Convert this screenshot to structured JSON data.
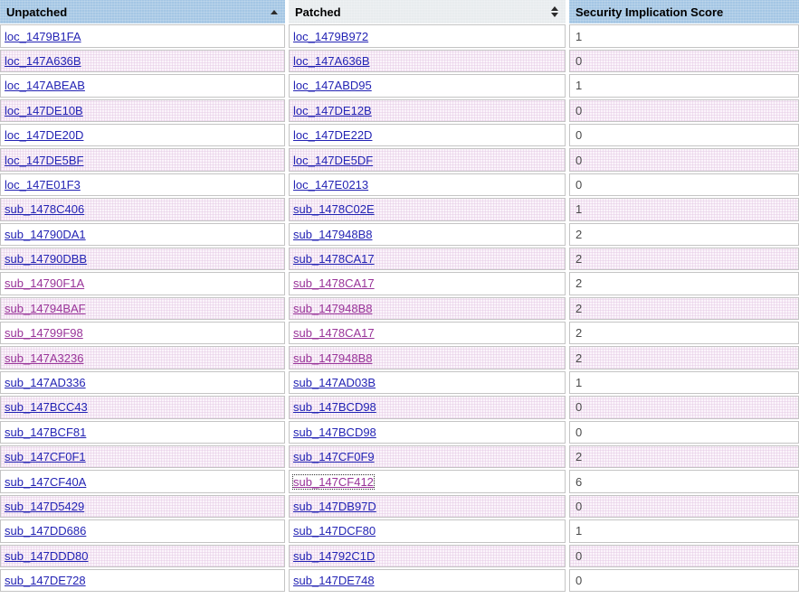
{
  "table": {
    "columns": [
      {
        "label": "Unpatched",
        "sort_state": "ascending",
        "icon": "sort-ascending-icon"
      },
      {
        "label": "Patched",
        "sort_state": "sortable",
        "icon": "sort-up-down-icon"
      },
      {
        "label": "Security Implication Score",
        "sort_state": "none",
        "icon": null
      }
    ],
    "rows": [
      {
        "unpatched": {
          "text": "loc_1479B1FA",
          "visited": false
        },
        "patched": {
          "text": "loc_1479B972",
          "visited": false,
          "focused": false
        },
        "score": "1"
      },
      {
        "unpatched": {
          "text": "loc_147A636B",
          "visited": false
        },
        "patched": {
          "text": "loc_147A636B",
          "visited": false,
          "focused": false
        },
        "score": "0"
      },
      {
        "unpatched": {
          "text": "loc_147ABEAB",
          "visited": false
        },
        "patched": {
          "text": "loc_147ABD95",
          "visited": false,
          "focused": false
        },
        "score": "1"
      },
      {
        "unpatched": {
          "text": "loc_147DE10B",
          "visited": false
        },
        "patched": {
          "text": "loc_147DE12B",
          "visited": false,
          "focused": false
        },
        "score": "0"
      },
      {
        "unpatched": {
          "text": "loc_147DE20D",
          "visited": false
        },
        "patched": {
          "text": "loc_147DE22D",
          "visited": false,
          "focused": false
        },
        "score": "0"
      },
      {
        "unpatched": {
          "text": "loc_147DE5BF",
          "visited": false
        },
        "patched": {
          "text": "loc_147DE5DF",
          "visited": false,
          "focused": false
        },
        "score": "0"
      },
      {
        "unpatched": {
          "text": "loc_147E01F3",
          "visited": false
        },
        "patched": {
          "text": "loc_147E0213",
          "visited": false,
          "focused": false
        },
        "score": "0"
      },
      {
        "unpatched": {
          "text": "sub_1478C406",
          "visited": false
        },
        "patched": {
          "text": "sub_1478C02E",
          "visited": false,
          "focused": false
        },
        "score": "1"
      },
      {
        "unpatched": {
          "text": "sub_14790DA1",
          "visited": false
        },
        "patched": {
          "text": "sub_147948B8",
          "visited": false,
          "focused": false
        },
        "score": "2"
      },
      {
        "unpatched": {
          "text": "sub_14790DBB",
          "visited": false
        },
        "patched": {
          "text": "sub_1478CA17",
          "visited": false,
          "focused": false
        },
        "score": "2"
      },
      {
        "unpatched": {
          "text": "sub_14790F1A",
          "visited": true
        },
        "patched": {
          "text": "sub_1478CA17",
          "visited": true,
          "focused": false
        },
        "score": "2"
      },
      {
        "unpatched": {
          "text": "sub_14794BAF",
          "visited": true
        },
        "patched": {
          "text": "sub_147948B8",
          "visited": true,
          "focused": false
        },
        "score": "2"
      },
      {
        "unpatched": {
          "text": "sub_14799F98",
          "visited": true
        },
        "patched": {
          "text": "sub_1478CA17",
          "visited": true,
          "focused": false
        },
        "score": "2"
      },
      {
        "unpatched": {
          "text": "sub_147A3236",
          "visited": true
        },
        "patched": {
          "text": "sub_147948B8",
          "visited": true,
          "focused": false
        },
        "score": "2"
      },
      {
        "unpatched": {
          "text": "sub_147AD336",
          "visited": false
        },
        "patched": {
          "text": "sub_147AD03B",
          "visited": false,
          "focused": false
        },
        "score": "1"
      },
      {
        "unpatched": {
          "text": "sub_147BCC43",
          "visited": false
        },
        "patched": {
          "text": "sub_147BCD98",
          "visited": false,
          "focused": false
        },
        "score": "0"
      },
      {
        "unpatched": {
          "text": "sub_147BCF81",
          "visited": false
        },
        "patched": {
          "text": "sub_147BCD98",
          "visited": false,
          "focused": false
        },
        "score": "0"
      },
      {
        "unpatched": {
          "text": "sub_147CF0F1",
          "visited": false
        },
        "patched": {
          "text": "sub_147CF0F9",
          "visited": false,
          "focused": false
        },
        "score": "2"
      },
      {
        "unpatched": {
          "text": "sub_147CF40A",
          "visited": false
        },
        "patched": {
          "text": "sub_147CF412",
          "visited": true,
          "focused": true
        },
        "score": "6"
      },
      {
        "unpatched": {
          "text": "sub_147D5429",
          "visited": false
        },
        "patched": {
          "text": "sub_147DB97D",
          "visited": false,
          "focused": false
        },
        "score": "0"
      },
      {
        "unpatched": {
          "text": "sub_147DD686",
          "visited": false
        },
        "patched": {
          "text": "sub_147DCF80",
          "visited": false,
          "focused": false
        },
        "score": "1"
      },
      {
        "unpatched": {
          "text": "sub_147DDD80",
          "visited": false
        },
        "patched": {
          "text": "sub_14792C1D",
          "visited": false,
          "focused": false
        },
        "score": "0"
      },
      {
        "unpatched": {
          "text": "sub_147DE728",
          "visited": false
        },
        "patched": {
          "text": "sub_147DE748",
          "visited": false,
          "focused": false
        },
        "score": "0"
      }
    ]
  },
  "colors": {
    "header_blue": "#a4c6e4",
    "header_hover": "#e8ecee",
    "alt_row_pink": "#f6eef6",
    "link_blue": "#2323b4",
    "link_visited_purple": "#993399"
  }
}
